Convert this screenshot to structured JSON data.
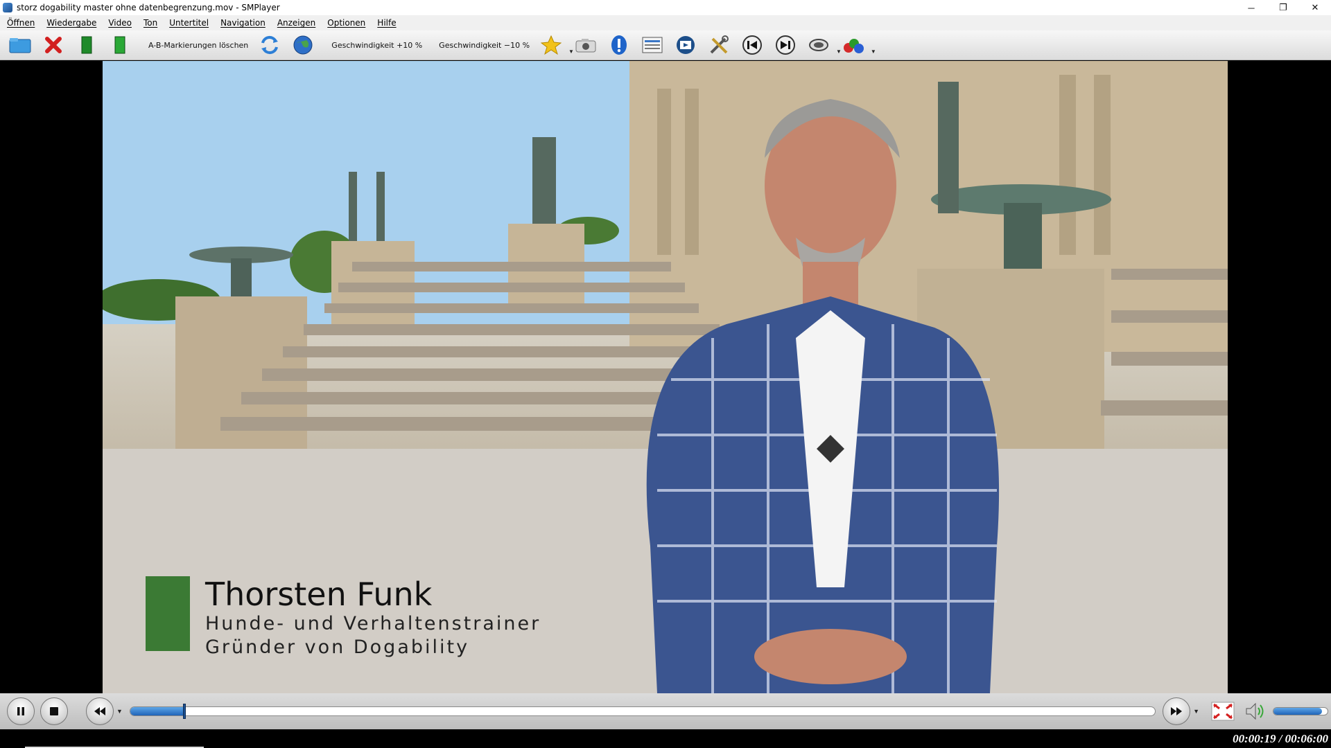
{
  "window": {
    "title": "storz dogability master ohne datenbegrenzung.mov - SMPlayer",
    "minimize": "─",
    "restore": "❐",
    "close": "✕"
  },
  "menu": [
    "Öffnen",
    "Wiedergabe",
    "Video",
    "Ton",
    "Untertitel",
    "Navigation",
    "Anzeigen",
    "Optionen",
    "Hilfe"
  ],
  "toolbar": {
    "ab_clear": "A-B-Markierungen löschen",
    "speed_up": "Geschwindigkeit +10 %",
    "speed_down": "Geschwindigkeit −10 %"
  },
  "video": {
    "name": "Thorsten Funk",
    "line1": "Hunde- und Verhaltenstrainer",
    "line2": "Gründer von Dogability"
  },
  "playback": {
    "time": "00:00:19 / 00:06:00",
    "progress": 0.053,
    "volume": 0.9
  },
  "colors": {
    "accent": "#2064b8",
    "lower_third_bar": "#3b7a34"
  }
}
